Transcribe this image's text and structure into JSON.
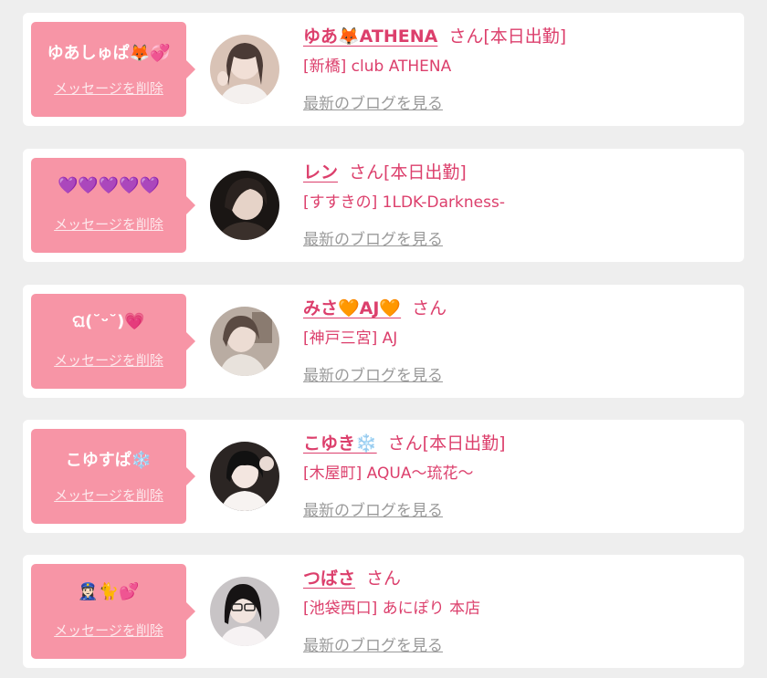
{
  "delete_label": "メッセージを削除",
  "blog_label": "最新のブログを見る",
  "colors": {
    "accent": "#dc3f6c",
    "bubble": "#f795a6",
    "background": "#eeeeee"
  },
  "cards": [
    {
      "message": "ゆあしゅぱ🦊💞",
      "name": "ゆあ🦊ATHENA",
      "status": "さん[本日出勤]",
      "shop": "[新橋] club ATHENA",
      "avatar_icon": "profile-photo-icon"
    },
    {
      "message": "💜💜💜💜💜",
      "name": "レン",
      "status": "さん[本日出勤]",
      "shop": "[すすきの] 1LDK-Darkness-",
      "avatar_icon": "profile-photo-icon"
    },
    {
      "message": "ଘ(˘ᵕ˘)💗",
      "name": "みさ🧡AJ🧡",
      "status": "さん",
      "shop": "[神戸三宮] AJ",
      "avatar_icon": "profile-photo-icon"
    },
    {
      "message": "こゆすぱ❄️",
      "name": "こゆき❄️",
      "status": "さん[本日出勤]",
      "shop": "[木屋町] AQUA～琉花～",
      "avatar_icon": "profile-photo-icon"
    },
    {
      "message": "👮🏻‍♀️🐈💕",
      "name": "つばさ",
      "status": "さん",
      "shop": "[池袋西口] あにぽり 本店",
      "avatar_icon": "profile-photo-icon"
    }
  ]
}
